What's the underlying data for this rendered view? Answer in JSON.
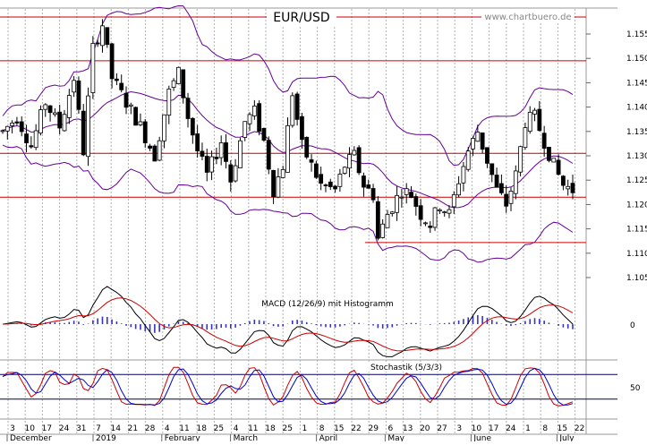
{
  "chart_data": [
    {
      "type": "candlestick",
      "title": "EUR/USD",
      "watermark": "www.chartbuero.de",
      "ylim": [
        1.1,
        1.16
      ],
      "yticks": [
        "1.155",
        "1.150",
        "1.145",
        "1.140",
        "1.135",
        "1.130",
        "1.125",
        "1.120",
        "1.115",
        "1.110",
        "1.105"
      ],
      "horizontal_lines": [
        1.1585,
        1.1495,
        1.1305,
        1.1215
      ],
      "support_line": 1.1122,
      "grid": "vertical dotted",
      "colors": {
        "up": "#ffffff",
        "down": "#000000",
        "bollinger": "#660099",
        "resistance": "#cc0000"
      },
      "path": [
        [
          0,
          1.135
        ],
        [
          3,
          1.138
        ],
        [
          6,
          1.132
        ],
        [
          9,
          1.141
        ],
        [
          12,
          1.136
        ],
        [
          15,
          1.146
        ],
        [
          17,
          1.131
        ],
        [
          19,
          1.152
        ],
        [
          21,
          1.157
        ],
        [
          23,
          1.146
        ],
        [
          26,
          1.141
        ],
        [
          29,
          1.136
        ],
        [
          32,
          1.13
        ],
        [
          35,
          1.143
        ],
        [
          37,
          1.147
        ],
        [
          39,
          1.138
        ],
        [
          41,
          1.131
        ],
        [
          43,
          1.126
        ],
        [
          46,
          1.133
        ],
        [
          48,
          1.125
        ],
        [
          51,
          1.137
        ],
        [
          53,
          1.139
        ],
        [
          55,
          1.133
        ],
        [
          57,
          1.123
        ],
        [
          59,
          1.128
        ],
        [
          61,
          1.143
        ],
        [
          63,
          1.132
        ],
        [
          65,
          1.128
        ],
        [
          67,
          1.124
        ],
        [
          70,
          1.123
        ],
        [
          72,
          1.128
        ],
        [
          74,
          1.13
        ],
        [
          76,
          1.124
        ],
        [
          78,
          1.122
        ],
        [
          79,
          1.113
        ],
        [
          81,
          1.118
        ],
        [
          84,
          1.123
        ],
        [
          86,
          1.122
        ],
        [
          88,
          1.118
        ],
        [
          90,
          1.116
        ],
        [
          92,
          1.12
        ],
        [
          94,
          1.118
        ],
        [
          96,
          1.125
        ],
        [
          98,
          1.131
        ],
        [
          100,
          1.135
        ],
        [
          102,
          1.129
        ],
        [
          104,
          1.123
        ],
        [
          106,
          1.12
        ],
        [
          108,
          1.126
        ],
        [
          110,
          1.137
        ],
        [
          112,
          1.138
        ],
        [
          114,
          1.133
        ],
        [
          116,
          1.128
        ],
        [
          118,
          1.124
        ],
        [
          120,
          1.123
        ]
      ]
    },
    {
      "type": "line",
      "title": "MACD (12/26/9) mit Histogramm",
      "yticks": [
        "0"
      ],
      "series": [
        {
          "color": "#000000"
        },
        {
          "color": "#cc0000"
        },
        {
          "color": "#3333cc"
        }
      ]
    },
    {
      "type": "line",
      "title": "Stochastik (5/3/3)",
      "yticks": [
        "50"
      ],
      "reference_lines": [
        80,
        20
      ],
      "series": [
        {
          "color": "#cc0000"
        },
        {
          "color": "#0000cc"
        }
      ]
    }
  ],
  "xaxis": {
    "days": [
      "3",
      "10",
      "17",
      "24",
      "31",
      "7",
      "14",
      "21",
      "28",
      "4",
      "11",
      "18",
      "25",
      "4",
      "11",
      "18",
      "25",
      "1",
      "8",
      "15",
      "22",
      "29",
      "6",
      "13",
      "20",
      "27",
      "3",
      "10",
      "17",
      "24",
      "1",
      "8",
      "15",
      "22"
    ],
    "months": [
      "December",
      "2019",
      "February",
      "March",
      "April",
      "May",
      "June",
      "July"
    ]
  }
}
